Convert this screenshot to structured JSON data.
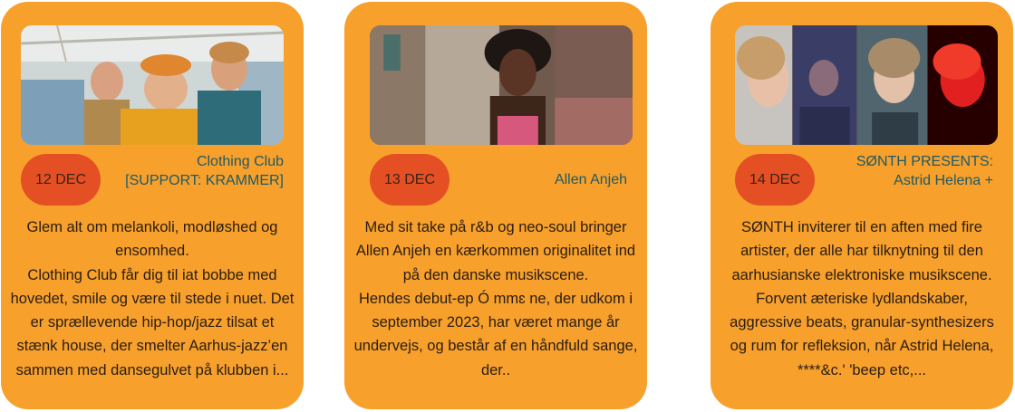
{
  "events": [
    {
      "date": "12 DEC",
      "title": "Clothing Club\n[SUPPORT: KRAMMER]",
      "description": "Glem alt om melankoli, modløshed og ensomhed.\nClothing Club får dig til  iat bobbe med hovedet, smile og være til stede i nuet. Det er sprællevende hip-hop/jazz tilsat et stænk house, der smelter Aarhus-jazz’en sammen med dansegulvet på klubben i..."
    },
    {
      "date": "13 DEC",
      "title": "Allen Anjeh",
      "description": "Med sit take på r&b og neo-soul bringer Allen Anjeh en kærkommen originalitet ind på den danske musikscene.\nHendes debut-ep Ó mmɛ ne, der udkom i september 2023, har været mange år undervejs, og består af en håndfuld sange, der.."
    },
    {
      "date": "14 DEC",
      "title": "SØNTH PRESENTS:\nAstrid Helena +",
      "description": "SØNTH inviterer til en aften med fire artister, der alle har tilknytning til den aarhusianske elektroniske musikscene. Forvent æteriske lydlandskaber, aggressive beats, granular-synthesizers og rum for refleksion, når Astrid Helena, ****&c.' 'beep etc,..."
    }
  ],
  "colors": {
    "card": "#f7a02c",
    "date_pill": "#e44f24",
    "title_text": "#1f5a66"
  }
}
